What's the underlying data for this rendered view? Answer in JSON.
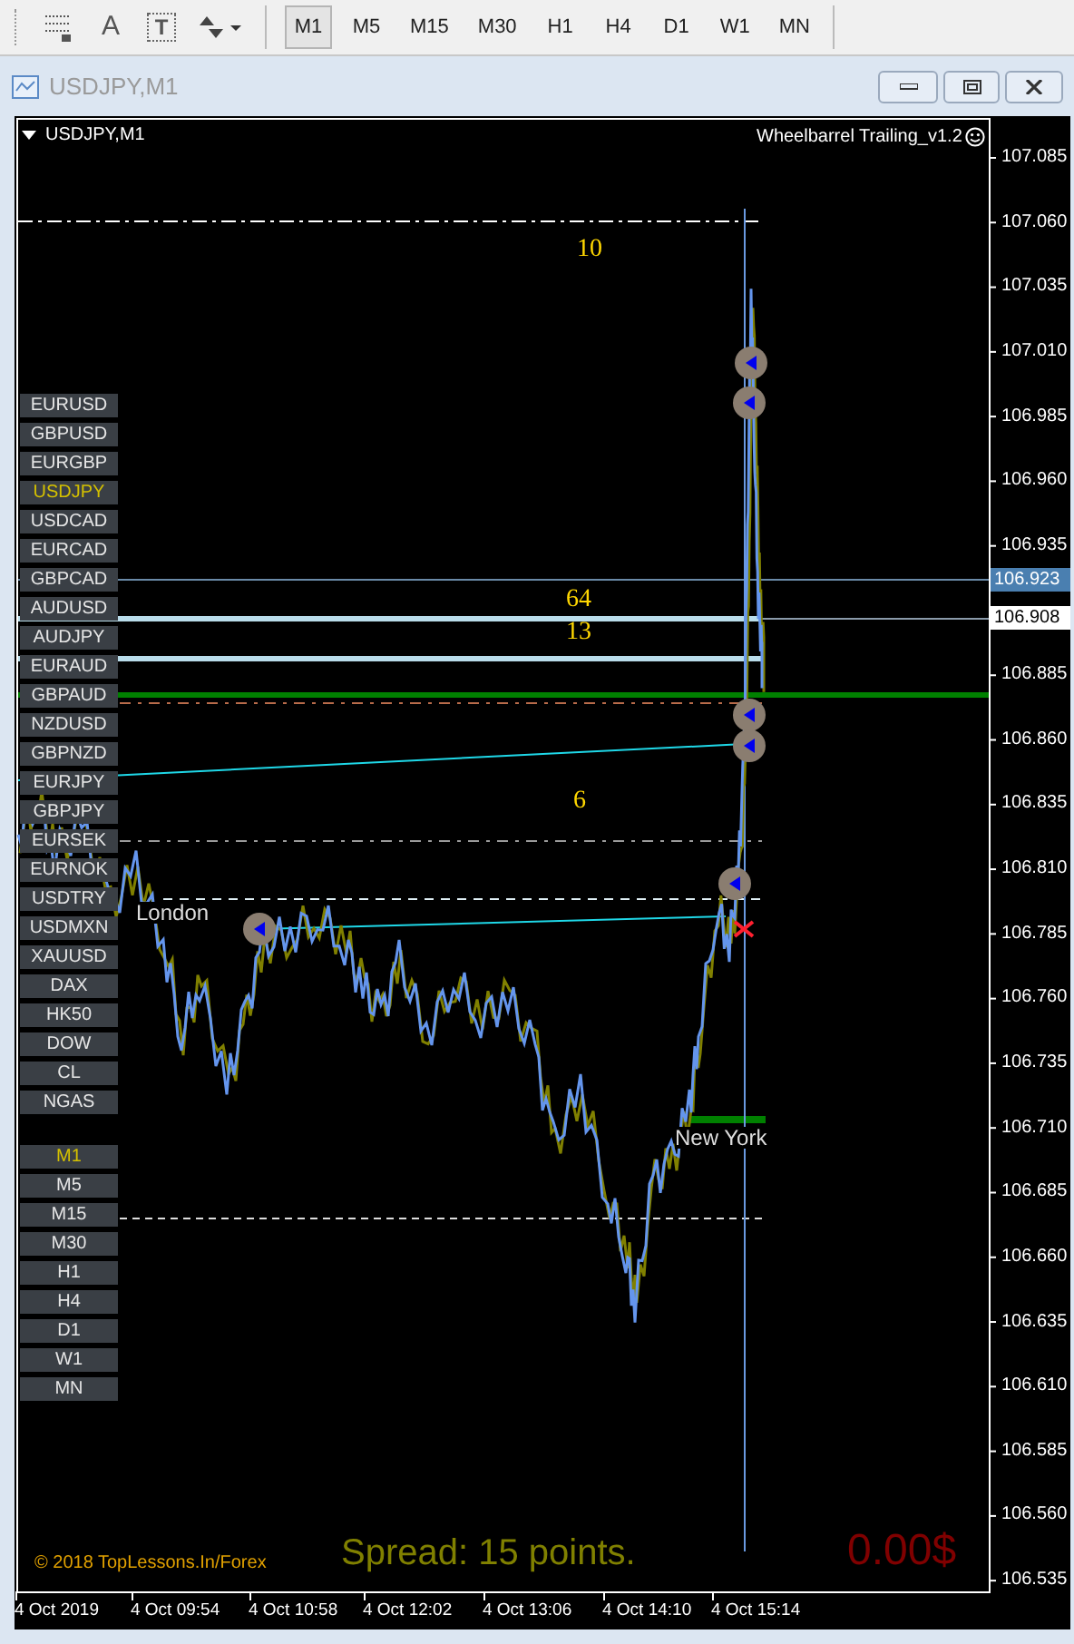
{
  "toolbar": {
    "tools": [
      {
        "kind": "grid"
      },
      {
        "kind": "glyph",
        "glyph": "A"
      },
      {
        "kind": "boxed",
        "glyph": "T"
      },
      {
        "kind": "arrows"
      }
    ],
    "timeframes": [
      {
        "label": "M1",
        "selected": true
      },
      {
        "label": "M5",
        "selected": false
      },
      {
        "label": "M15",
        "selected": false
      },
      {
        "label": "M30",
        "selected": false
      },
      {
        "label": "H1",
        "selected": false
      },
      {
        "label": "H4",
        "selected": false
      },
      {
        "label": "D1",
        "selected": false
      },
      {
        "label": "W1",
        "selected": false
      },
      {
        "label": "MN",
        "selected": false
      }
    ]
  },
  "window": {
    "title": "USDJPY,M1"
  },
  "chart": {
    "symbol_label": "USDJPY,M1",
    "indicator": "Wheelbarrel Trailing_v1.2",
    "symbols": [
      {
        "label": "EURUSD",
        "selected": false
      },
      {
        "label": "GBPUSD",
        "selected": false
      },
      {
        "label": "EURGBP",
        "selected": false
      },
      {
        "label": "USDJPY",
        "selected": true
      },
      {
        "label": "USDCAD",
        "selected": false
      },
      {
        "label": "EURCAD",
        "selected": false
      },
      {
        "label": "GBPCAD",
        "selected": false
      },
      {
        "label": "AUDUSD",
        "selected": false
      },
      {
        "label": "AUDJPY",
        "selected": false
      },
      {
        "label": "EURAUD",
        "selected": false
      },
      {
        "label": "GBPAUD",
        "selected": false
      },
      {
        "label": "NZDUSD",
        "selected": false
      },
      {
        "label": "GBPNZD",
        "selected": false
      },
      {
        "label": "EURJPY",
        "selected": false
      },
      {
        "label": "GBPJPY",
        "selected": false
      },
      {
        "label": "EURSEK",
        "selected": false
      },
      {
        "label": "EURNOK",
        "selected": false
      },
      {
        "label": "USDTRY",
        "selected": false
      },
      {
        "label": "USDMXN",
        "selected": false
      },
      {
        "label": "XAUUSD",
        "selected": false
      },
      {
        "label": "DAX",
        "selected": false
      },
      {
        "label": "HK50",
        "selected": false
      },
      {
        "label": "DOW",
        "selected": false
      },
      {
        "label": "CL",
        "selected": false
      },
      {
        "label": "NGAS",
        "selected": false
      }
    ],
    "timeframes": [
      {
        "label": "M1",
        "selected": true
      },
      {
        "label": "M5",
        "selected": false
      },
      {
        "label": "M15",
        "selected": false
      },
      {
        "label": "M30",
        "selected": false
      },
      {
        "label": "H1",
        "selected": false
      },
      {
        "label": "H4",
        "selected": false
      },
      {
        "label": "D1",
        "selected": false
      },
      {
        "label": "W1",
        "selected": false
      },
      {
        "label": "MN",
        "selected": false
      }
    ],
    "level_labels": [
      "10",
      "64",
      "13",
      "6"
    ],
    "session_labels": [
      "London",
      "New York"
    ],
    "price_axis": [
      "107.085",
      "107.060",
      "107.035",
      "107.010",
      "106.985",
      "106.960",
      "106.935",
      "106.885",
      "106.860",
      "106.835",
      "106.810",
      "106.785",
      "106.760",
      "106.735",
      "106.710",
      "106.685",
      "106.660",
      "106.635",
      "106.610",
      "106.585",
      "106.560",
      "106.535"
    ],
    "price_tags": [
      {
        "value": "106.923",
        "kind": "bid"
      },
      {
        "value": "106.908",
        "kind": "line"
      }
    ],
    "time_axis": [
      "4 Oct 2019",
      "4 Oct 09:54",
      "4 Oct 10:58",
      "4 Oct 12:02",
      "4 Oct 13:06",
      "4 Oct 14:10",
      "4 Oct 15:14"
    ],
    "copyright": "© 2018 TopLessons.In/Forex",
    "spread": "Spread: 15 points.",
    "profit": "0.00$"
  }
}
